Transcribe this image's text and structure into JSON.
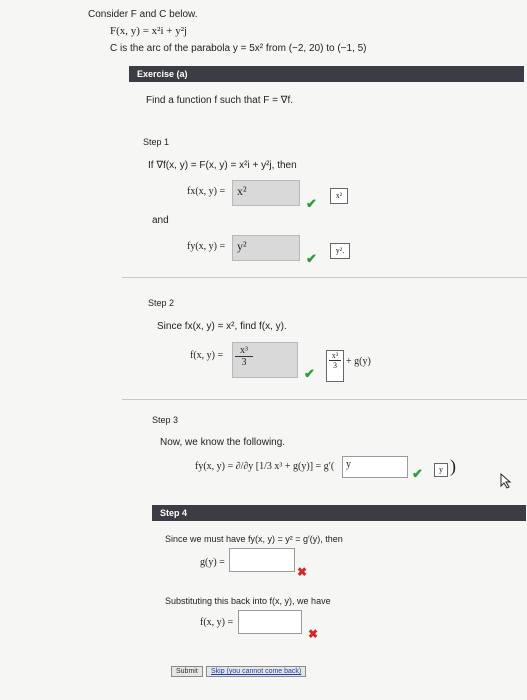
{
  "problem": {
    "intro": "Consider F and C below.",
    "field": "F(x, y) = x²i + y²j",
    "curve": "C is the arc of the parabola y = 5x² from (−2, 20) to (−1, 5)"
  },
  "exercise": {
    "header": "Exercise (a)",
    "prompt": "Find a function f such that F = ∇f."
  },
  "step1": {
    "title": "Step 1",
    "text": "If ∇f(x, y) = F(x, y) = x²i + y²j, then",
    "fx_label": "fx(x, y) =",
    "fx_value": "x²",
    "fx_answer": "x²",
    "and": "and",
    "fy_label": "fy(x, y) =",
    "fy_value": "y²",
    "fy_answer": "y²."
  },
  "step2": {
    "title": "Step 2",
    "text": "Since fx(x, y) = x², find f(x, y).",
    "f_label": "f(x, y) =",
    "f_value_num": "x³",
    "f_value_den": "3",
    "f_answer_num": "x³",
    "f_answer_den": "3",
    "plus_g": "+ g(y)"
  },
  "step3": {
    "title": "Step 3",
    "text": "Now, we know the following.",
    "equation": "fy(x, y) = ∂/∂y [1/3 x³ + g(y)] = g′(",
    "input_value": "y",
    "answer": "y",
    "close": ")"
  },
  "step4": {
    "header": "Step 4",
    "text": "Since we must have fy(x, y) = y² = g′(y), then",
    "g_label": "g(y) =",
    "substitute": "Substituting this back into f(x, y), we have",
    "f_label": "f(x, y) =",
    "submit": "Submit",
    "skip": "Skip (you cannot come back)"
  },
  "colors": {
    "header_bg": "#3c3c44",
    "check": "#2e9b3a",
    "cross": "#d02a2a"
  }
}
